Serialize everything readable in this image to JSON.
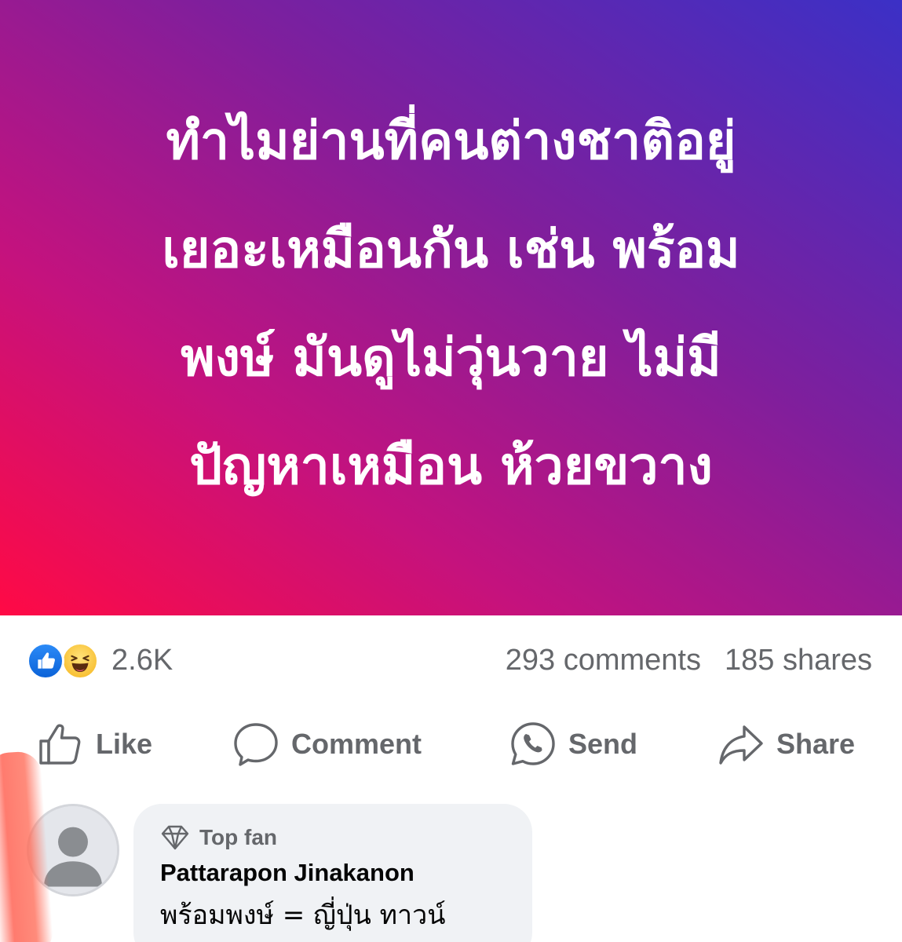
{
  "post": {
    "text_lines": [
      "ทำไมย่านที่คนต่างชาติอยู่",
      "เยอะเหมือนกัน เช่น พร้อม",
      "พงษ์ มันดูไม่วุ่นวาย ไม่มี",
      "ปัญหาเหมือน ห้วยขวาง"
    ],
    "gradient_colors": [
      "#ff0a45",
      "#c4127e",
      "#7e1f9d",
      "#3b30c6"
    ]
  },
  "summary": {
    "reaction_icons": [
      "like-reaction-icon",
      "haha-reaction-icon"
    ],
    "reaction_count": "2.6K",
    "comments": "293 comments",
    "shares": "185 shares"
  },
  "actions": {
    "like": "Like",
    "comment": "Comment",
    "send": "Send",
    "share": "Share"
  },
  "comment": {
    "badge": "Top fan",
    "author": "Pattarapon Jinakanon",
    "text": "พร้อมพงษ์ = ญี่ปุ่น ทาวน์"
  },
  "colors": {
    "secondary_text": "#65676b",
    "bubble_bg": "#f0f2f5",
    "like_blue": "#1877f2"
  }
}
